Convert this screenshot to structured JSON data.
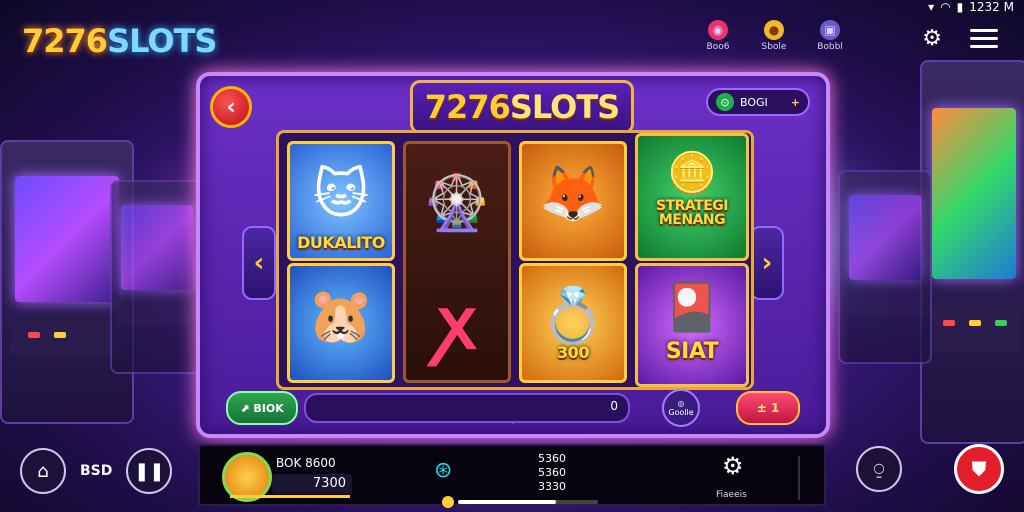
{
  "brand": {
    "logo_main": "7276",
    "logo_suffix": "SLOTS"
  },
  "status": {
    "time": "1232 M"
  },
  "top_icons": [
    {
      "label": "Boo6",
      "icon": "lollipop-icon",
      "color": "#e9336c",
      "glyph": "◉"
    },
    {
      "label": "Sbole",
      "icon": "coin-icon",
      "color": "#f0b82a",
      "glyph": "●"
    },
    {
      "label": "Bobbl",
      "icon": "bag-icon",
      "color": "#6a5cc8",
      "glyph": "▣"
    }
  ],
  "panel": {
    "logo_main": "7276",
    "logo_suffix": "SLOTS",
    "coin_label": "BOGI",
    "coin_plus": "+"
  },
  "tiles": [
    {
      "name": "tile-dukalito",
      "label": "DUKALITO",
      "art": "🐱"
    },
    {
      "name": "tile-hamster",
      "label": "",
      "art": "🐹"
    },
    {
      "name": "tile-wheel",
      "label": "",
      "art": "🎡"
    },
    {
      "name": "tile-fox",
      "label": "",
      "art": "🦊"
    },
    {
      "name": "tile-ring",
      "label": "300",
      "art": "💍"
    },
    {
      "name": "tile-strategi",
      "label": "STRATEGI MENANG",
      "art": "🪙"
    },
    {
      "name": "tile-siat",
      "label": "SIAT",
      "art": "🎴"
    }
  ],
  "controls": {
    "green_btn": "BIOK",
    "bet_value": "0",
    "mini_label": "Goolle",
    "red_btn": "1"
  },
  "bottom": {
    "left_label": "BSD",
    "balance_top": "BOK 8600",
    "balance_value": "7300",
    "stat1": "5360",
    "stat2": "5360",
    "stat3": "3330",
    "progress": 0.7,
    "settings_label": "Fiaeeis"
  }
}
